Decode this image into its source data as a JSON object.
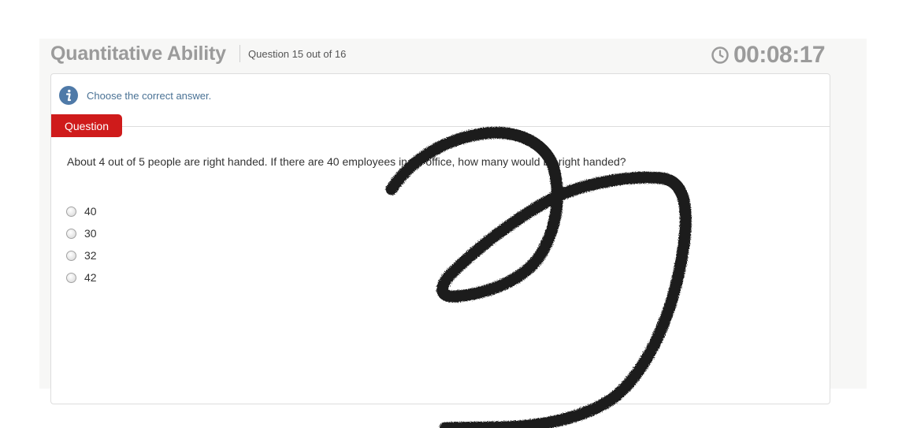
{
  "header": {
    "title": "Quantitative Ability",
    "progress": "Question 15 out of 16",
    "timer": "00:08:17"
  },
  "instruction": "Choose the correct answer.",
  "question_tab_label": "Question",
  "question": {
    "text": "About 4 out of 5 people are right handed. If there are 40 employees in an office, how many would be right handed?",
    "options": [
      "40",
      "30",
      "32",
      "42"
    ]
  },
  "colors": {
    "accent_red": "#cf1b1b",
    "info_blue": "#4a7295",
    "header_gray": "#9b9b9b"
  },
  "icons": [
    "info-icon",
    "clock-icon"
  ]
}
